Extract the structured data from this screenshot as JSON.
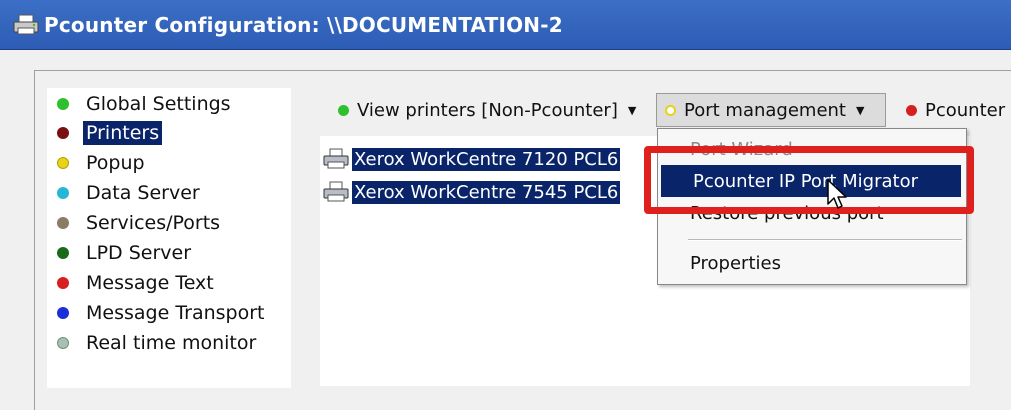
{
  "window": {
    "title": "Pcounter Configuration: \\\\DOCUMENTATION-2",
    "icon": "printer-icon"
  },
  "sidebar": {
    "items": [
      {
        "label": "Global Settings",
        "color": "#2fbf2f"
      },
      {
        "label": "Printers",
        "color": "#7a1010",
        "selected": true
      },
      {
        "label": "Popup",
        "color": "#e8d21a"
      },
      {
        "label": "Data Server",
        "color": "#25b8d6"
      },
      {
        "label": "Services/Ports",
        "color": "#8a7a66"
      },
      {
        "label": "LPD Server",
        "color": "#1a6a1a"
      },
      {
        "label": "Message Text",
        "color": "#d62020"
      },
      {
        "label": "Message Transport",
        "color": "#1b2fd6"
      },
      {
        "label": "Real time monitor",
        "color": "#a8c0b0"
      }
    ]
  },
  "toolbar": {
    "view_printers": {
      "label": "View printers [Non-Pcounter]",
      "color": "#2fbf2f"
    },
    "port_management": {
      "label": "Port management",
      "color": "#e8d21a"
    },
    "pcounter": {
      "label": "Pcounter",
      "color": "#d62020"
    }
  },
  "printers": [
    {
      "label": "Xerox WorkCentre 7120 PCL6",
      "icon": "printer-icon"
    },
    {
      "label": "Xerox WorkCentre 7545 PCL6",
      "icon": "printer-icon"
    }
  ],
  "port_menu": {
    "items": [
      {
        "label": "Port Wizard",
        "disabled": true
      },
      {
        "label": "Pcounter IP Port Migrator",
        "highlighted": true
      },
      {
        "label": "Restore previous port",
        "disabled": false
      },
      {
        "label": "Properties",
        "disabled": false
      }
    ]
  },
  "annotation": {
    "color": "#e0201c"
  }
}
